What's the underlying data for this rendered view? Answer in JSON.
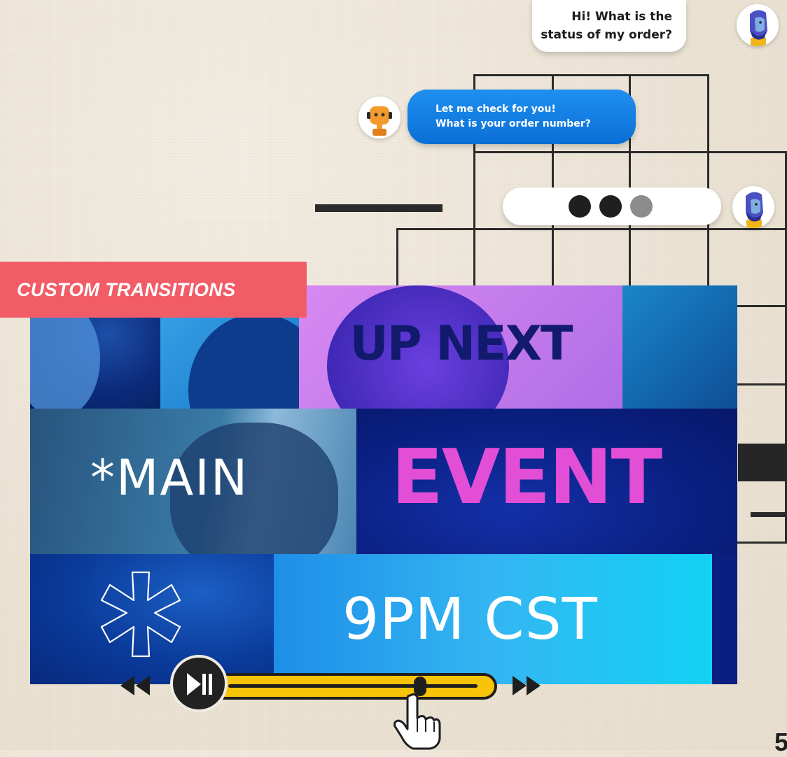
{
  "chat": {
    "user_message_line1": "Hi! What is the",
    "user_message_line2": "status of my order?",
    "bot_message_line1": "Let me check for you!",
    "bot_message_line2": "What is your order number?",
    "typing_dots": [
      "#1f1f1f",
      "#1f1f1f",
      "#8c8c8c"
    ]
  },
  "feature_label": "CUSTOM TRANSITIONS",
  "video": {
    "headline_top": "UP NEXT",
    "headline_left": "*MAIN",
    "headline_right": "EVENT",
    "time_text": "9PM CST"
  },
  "player": {
    "rewind_icon": "rewind-icon",
    "play_pause_icon": "play-pause-icon",
    "forward_icon": "fast-forward-icon",
    "progress": 0.77
  },
  "page_number": "5",
  "colors": {
    "tag_red": "#f25c66",
    "bot_blue": "#0a7ae0",
    "scrub_yellow": "#f8c409",
    "event_pink": "#e24ed6",
    "navy": "#0b2a8c"
  }
}
